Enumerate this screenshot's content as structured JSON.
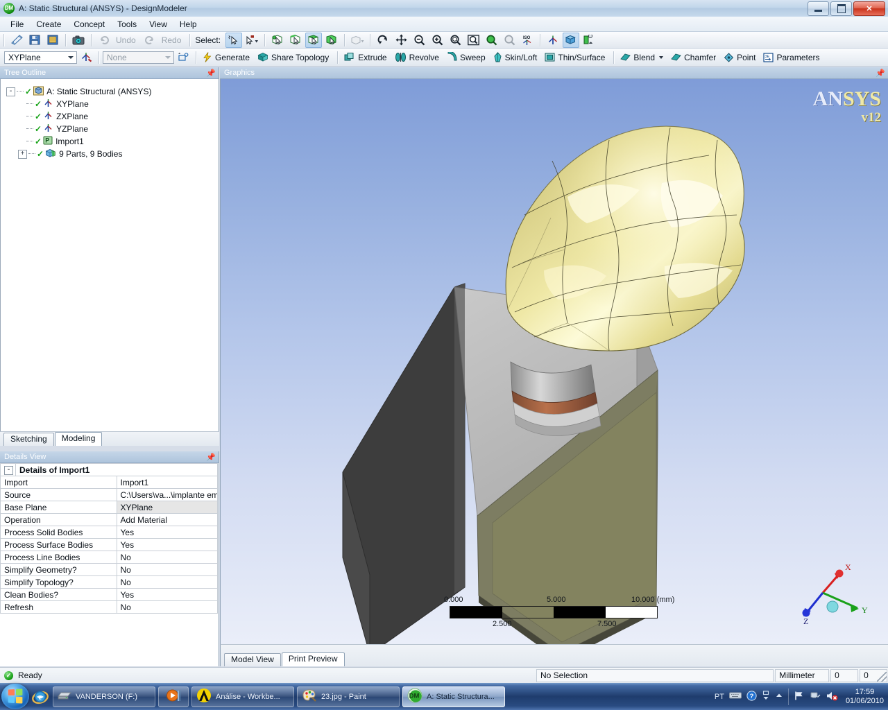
{
  "window": {
    "title": "A: Static Structural (ANSYS) - DesignModeler",
    "app_icon": "dm-icon",
    "minimize_label": "Minimize",
    "maximize_label": "Restore",
    "close_label": "Close"
  },
  "menu": {
    "items": [
      {
        "label": "File",
        "name": "menu-file"
      },
      {
        "label": "Create",
        "name": "menu-create"
      },
      {
        "label": "Concept",
        "name": "menu-concept"
      },
      {
        "label": "Tools",
        "name": "menu-tools"
      },
      {
        "label": "View",
        "name": "menu-view"
      },
      {
        "label": "Help",
        "name": "menu-help"
      }
    ]
  },
  "toolbar_main": {
    "new_label": "New",
    "save_label": "Save Project",
    "save_as_label": "Save As",
    "image_label": "Image Capture",
    "undo_label": "Undo",
    "redo_label": "Redo",
    "select_label": "Select:",
    "single_select_label": "Single Select",
    "box_select_label": "Box Select",
    "vertex_filter_label": "Select Vertices",
    "edge_filter_label": "Select Edges",
    "face_filter_label": "Select Faces",
    "body_filter_label": "Select Bodies",
    "extend_label": "Extend Selection",
    "rotate_label": "Rotate",
    "pan_label": "Pan",
    "zoom_label": "Zoom",
    "zoom_in_label": "Zoom In",
    "box_zoom_label": "Box Zoom",
    "fit_label": "Zoom to Fit",
    "magnifier_label": "Magnifier",
    "previous_view_label": "Previous View",
    "iso_label": "ISO",
    "look_at_label": "Look At",
    "display_plane_label": "Display Plane",
    "display_model_label": "Display Model"
  },
  "toolbar_model": {
    "plane_value": "XYPlane",
    "new_plane_label": "New Plane",
    "sketch_value": "None",
    "new_sketch_label": "New Sketch",
    "generate_label": "Generate",
    "share_topology_label": "Share Topology",
    "extrude_label": "Extrude",
    "revolve_label": "Revolve",
    "sweep_label": "Sweep",
    "skin_loft_label": "Skin/Loft",
    "thin_surface_label": "Thin/Surface",
    "blend_label": "Blend",
    "chamfer_label": "Chamfer",
    "point_label": "Point",
    "parameters_label": "Parameters"
  },
  "tree_panel": {
    "title": "Tree Outline",
    "pin_label": "Auto Hide",
    "items": [
      {
        "label": "A: Static Structural (ANSYS)",
        "indent": 0,
        "icon": "project-icon",
        "expander": "-",
        "checked": true
      },
      {
        "label": "XYPlane",
        "indent": 1,
        "icon": "plane-icon",
        "expander": "",
        "checked": true
      },
      {
        "label": "ZXPlane",
        "indent": 1,
        "icon": "plane-icon",
        "expander": "",
        "checked": true
      },
      {
        "label": "YZPlane",
        "indent": 1,
        "icon": "plane-icon",
        "expander": "",
        "checked": true
      },
      {
        "label": "Import1",
        "indent": 1,
        "icon": "import-icon",
        "expander": "",
        "checked": true
      },
      {
        "label": "9 Parts, 9 Bodies",
        "indent": 1,
        "icon": "bodies-icon",
        "expander": "+",
        "checked": true
      }
    ],
    "tabs": [
      {
        "label": "Sketching",
        "active": false,
        "name": "tab-sketching"
      },
      {
        "label": "Modeling",
        "active": true,
        "name": "tab-modeling"
      }
    ]
  },
  "details_panel": {
    "title": "Details View",
    "pin_label": "Auto Hide",
    "group_label": "Details of Import1",
    "group_expander": "-",
    "rows": [
      {
        "key": "Import",
        "value": "Import1",
        "shaded": false
      },
      {
        "key": "Source",
        "value": "C:\\Users\\va...\\implante emfills.x_t",
        "shaded": false
      },
      {
        "key": "Base Plane",
        "value": "XYPlane",
        "shaded": true
      },
      {
        "key": "Operation",
        "value": "Add Material",
        "shaded": false
      },
      {
        "key": "Process Solid Bodies",
        "value": "Yes",
        "shaded": false
      },
      {
        "key": "Process Surface Bodies",
        "value": "Yes",
        "shaded": false
      },
      {
        "key": "Process Line Bodies",
        "value": "No",
        "shaded": false
      },
      {
        "key": "Simplify Geometry?",
        "value": "No",
        "shaded": false
      },
      {
        "key": "Simplify Topology?",
        "value": "No",
        "shaded": false
      },
      {
        "key": "Clean Bodies?",
        "value": "Yes",
        "shaded": false
      },
      {
        "key": "Refresh",
        "value": "No",
        "shaded": false
      }
    ]
  },
  "graphics": {
    "title": "Graphics",
    "pin_label": "Auto Hide",
    "logo_part1": "AN",
    "logo_part2": "SYS",
    "logo_version": "v12",
    "scalebar": {
      "labels_top": [
        "0.000",
        "5.000",
        "10.000 (mm)"
      ],
      "labels_bottom": [
        "2.500",
        "7.500"
      ]
    },
    "triad": {
      "x_label": "X",
      "y_label": "Y",
      "z_label": "Z"
    },
    "tabs": [
      {
        "label": "Model View",
        "active": false,
        "name": "tab-model-view"
      },
      {
        "label": "Print Preview",
        "active": true,
        "name": "tab-print-preview"
      }
    ]
  },
  "statusbar": {
    "status_text": "Ready",
    "selection_text": "No Selection",
    "unit_text": "Millimeter",
    "coord1": "0",
    "coord2": "0"
  },
  "taskbar": {
    "start_label": "Start",
    "quick_launch": [
      {
        "label": "Internet Explorer",
        "name": "ie-icon"
      }
    ],
    "tasks": [
      {
        "label": "VANDERSON (F:)",
        "icon": "drive-icon",
        "active": false,
        "name": "taskbar-item-vanderson"
      },
      {
        "label": "",
        "icon": "media-player-icon",
        "active": false,
        "narrow": true,
        "name": "taskbar-item-media"
      },
      {
        "label": "Análise - Workbe...",
        "icon": "ansys-icon",
        "active": false,
        "name": "taskbar-item-analise"
      },
      {
        "label": "23.jpg - Paint",
        "icon": "paint-icon",
        "active": false,
        "name": "taskbar-item-paint"
      },
      {
        "label": "A: Static Structura...",
        "icon": "dm-icon",
        "active": true,
        "name": "taskbar-item-designmodeler"
      }
    ],
    "tray": {
      "language": "PT",
      "keyboard_label": "keyboard-icon",
      "help_label": "help-icon",
      "show_hidden_label": "show-hidden-icons",
      "flag_label": "action-center-icon",
      "network_label": "network-icon",
      "volume_label": "volume-muted-icon",
      "time": "17:59",
      "date": "01/06/2010"
    }
  }
}
